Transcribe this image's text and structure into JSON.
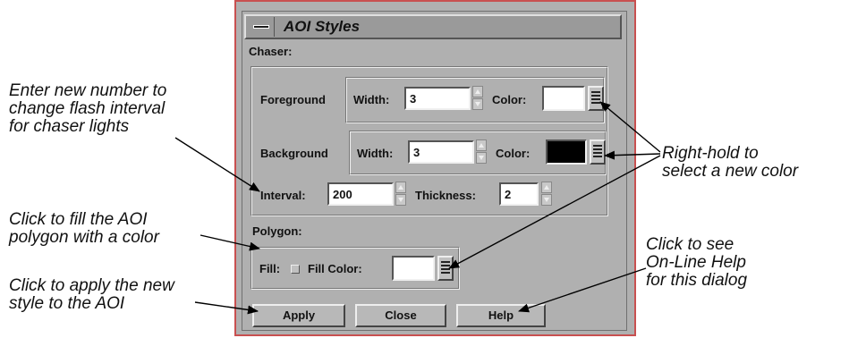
{
  "dialog": {
    "title": "AOI Styles",
    "chaser_label": "Chaser:",
    "foreground": {
      "label": "Foreground",
      "width_label": "Width:",
      "width_value": "3",
      "color_label": "Color:",
      "color": "#ffffff"
    },
    "background": {
      "label": "Background",
      "width_label": "Width:",
      "width_value": "3",
      "color_label": "Color:",
      "color": "#000000"
    },
    "interval": {
      "label": "Interval:",
      "value": "200"
    },
    "thickness": {
      "label": "Thickness:",
      "value": "2"
    },
    "polygon_label": "Polygon:",
    "fill": {
      "label": "Fill:",
      "color_label": "Fill Color:",
      "color": "#ffffff"
    },
    "buttons": {
      "apply": "Apply",
      "close": "Close",
      "help": "Help"
    }
  },
  "annotations": {
    "interval_note": [
      "Enter new number to",
      "change flash interval",
      "for chaser lights"
    ],
    "fill_note": [
      "Click to fill the AOI",
      "polygon with a color"
    ],
    "apply_note": [
      "Click to apply the new",
      "style to the AOI"
    ],
    "color_note": [
      "Right-hold to",
      "select a new color"
    ],
    "help_note": [
      "Click to see",
      "On-Line Help",
      "for this dialog"
    ]
  }
}
